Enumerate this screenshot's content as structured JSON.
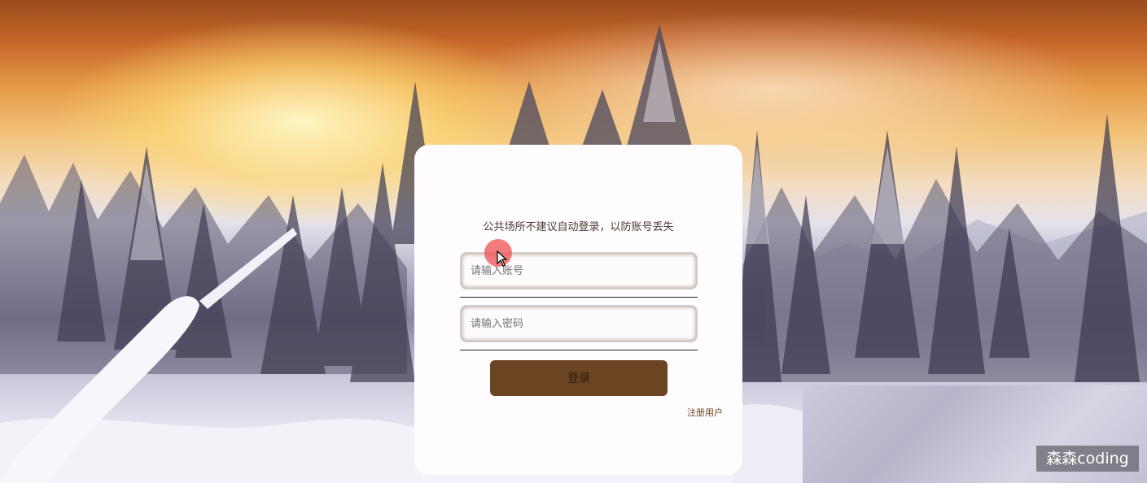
{
  "login_card": {
    "notice": "公共场所不建议自动登录，以防账号丢失",
    "username_placeholder": "请输入账号",
    "password_placeholder": "请输入密码",
    "login_label": "登录",
    "register_label": "注册用户"
  },
  "watermark": {
    "text": "森森coding"
  },
  "colors": {
    "button_brown": "#6b4522",
    "card_bg": "#fefcfe",
    "cursor_highlight": "#f05050"
  },
  "icons": {
    "cursor": "mouse-pointer-icon"
  }
}
